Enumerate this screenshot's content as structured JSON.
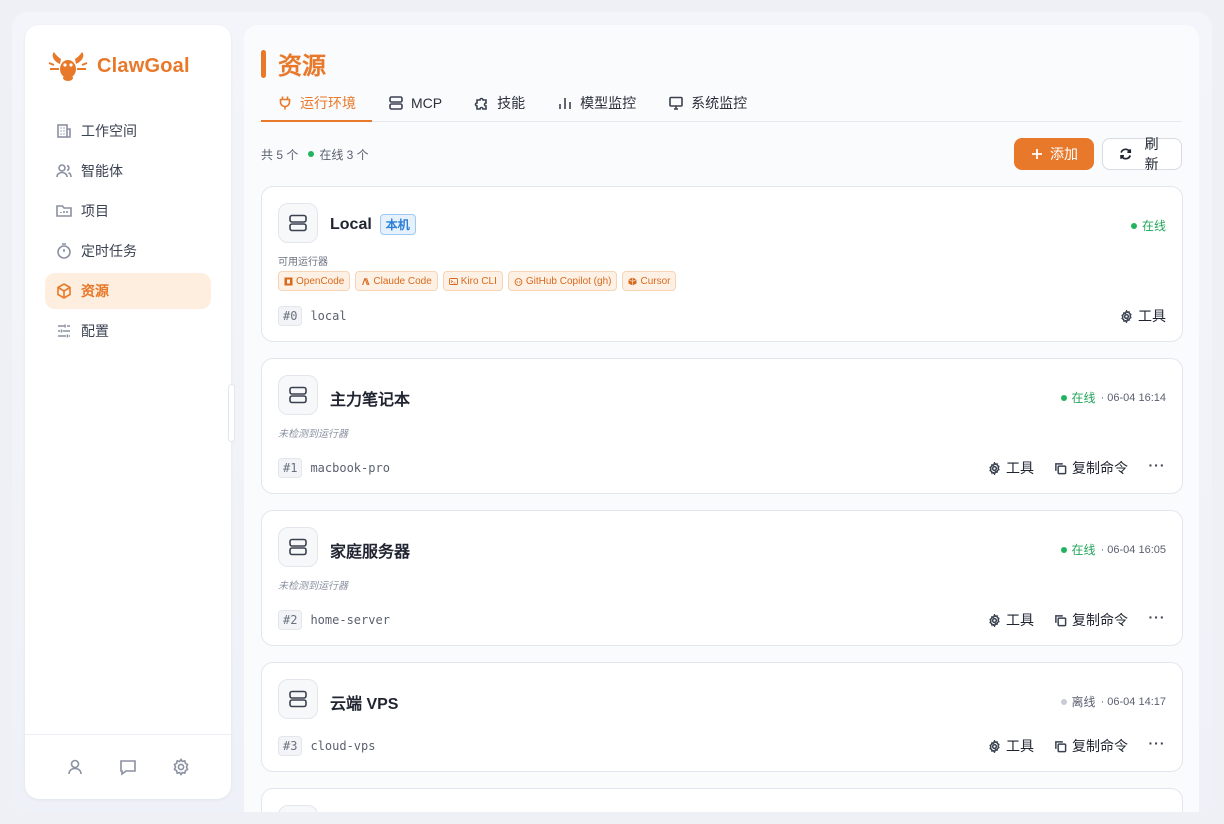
{
  "app": {
    "name": "ClawGoal",
    "accent": "#e8792a"
  },
  "sidebar": {
    "items": [
      {
        "label": "工作空间",
        "icon": "building-icon"
      },
      {
        "label": "智能体",
        "icon": "users-icon"
      },
      {
        "label": "项目",
        "icon": "folder-icon"
      },
      {
        "label": "定时任务",
        "icon": "timer-icon"
      },
      {
        "label": "资源",
        "icon": "box-icon",
        "active": true
      },
      {
        "label": "配置",
        "icon": "sliders-icon"
      }
    ],
    "footer": [
      "user-icon",
      "chat-icon",
      "settings-icon"
    ]
  },
  "page": {
    "title": "资源"
  },
  "tabs": [
    {
      "label": "运行环境",
      "icon": "plug-icon",
      "active": true
    },
    {
      "label": "MCP",
      "icon": "server-icon"
    },
    {
      "label": "技能",
      "icon": "puzzle-icon"
    },
    {
      "label": "模型监控",
      "icon": "bar-chart-icon"
    },
    {
      "label": "系统监控",
      "icon": "monitor-icon"
    }
  ],
  "toolbar": {
    "total": "共 5 个",
    "online": "在线 3 个",
    "add_label": "添加",
    "refresh_label": "刷新"
  },
  "cards": [
    {
      "name": "Local",
      "badge": "本机",
      "status": "在线",
      "status_color": "#22a55a",
      "time": "",
      "runners_label": "可用运行器",
      "runners": [
        "OpenCode",
        "Claude Code",
        "Kiro CLI",
        "GitHub Copilot (gh)",
        "Cursor"
      ],
      "id": "#0",
      "host": "local",
      "tools_label": "工具"
    },
    {
      "name": "主力笔记本",
      "status": "在线",
      "status_color": "#22a55a",
      "time": "· 06-04 16:14",
      "runners_none": "未检测到运行器",
      "id": "#1",
      "host": "macbook-pro",
      "tools_label": "工具",
      "copy_label": "复制命令",
      "more_label": "···"
    },
    {
      "name": "家庭服务器",
      "status": "在线",
      "status_color": "#22a55a",
      "time": "· 06-04 16:05",
      "runners_none": "未检测到运行器",
      "id": "#2",
      "host": "home-server",
      "tools_label": "工具",
      "copy_label": "复制命令",
      "more_label": "···"
    },
    {
      "name": "云端 VPS",
      "status": "离线",
      "status_color": "#c9ccd3",
      "time": "· 06-04 14:17",
      "id": "#3",
      "host": "cloud-vps",
      "tools_label": "工具",
      "copy_label": "复制命令",
      "more_label": "···"
    }
  ]
}
